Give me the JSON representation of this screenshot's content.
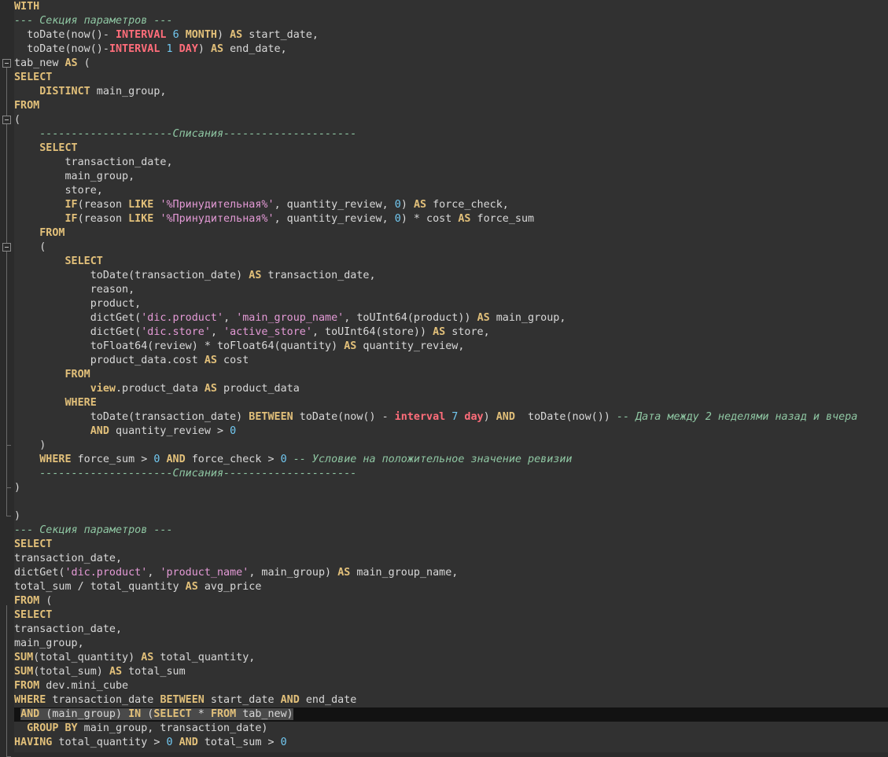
{
  "editor": {
    "lines": [
      [
        {
          "t": "WITH",
          "c": "kw"
        }
      ],
      [
        {
          "t": "--- Секция параметров ---",
          "c": "cmt"
        }
      ],
      [
        {
          "t": "  toDate(now()- ",
          "c": ""
        },
        {
          "t": "INTERVAL",
          "c": "kw2"
        },
        {
          "t": " ",
          "c": ""
        },
        {
          "t": "6",
          "c": "num"
        },
        {
          "t": " ",
          "c": ""
        },
        {
          "t": "MONTH",
          "c": "kw"
        },
        {
          "t": ") ",
          "c": ""
        },
        {
          "t": "AS",
          "c": "kw"
        },
        {
          "t": " start_date,",
          "c": ""
        }
      ],
      [
        {
          "t": "  toDate(now()-",
          "c": ""
        },
        {
          "t": "INTERVAL",
          "c": "kw2"
        },
        {
          "t": " ",
          "c": ""
        },
        {
          "t": "1",
          "c": "num"
        },
        {
          "t": " ",
          "c": ""
        },
        {
          "t": "DAY",
          "c": "kw2"
        },
        {
          "t": ") ",
          "c": ""
        },
        {
          "t": "AS",
          "c": "kw"
        },
        {
          "t": " end_date,",
          "c": ""
        }
      ],
      [
        {
          "t": "tab_new ",
          "c": ""
        },
        {
          "t": "AS",
          "c": "kw"
        },
        {
          "t": " (",
          "c": ""
        }
      ],
      [
        {
          "t": "SELECT",
          "c": "kw"
        }
      ],
      [
        {
          "t": "    ",
          "c": ""
        },
        {
          "t": "DISTINCT",
          "c": "kw"
        },
        {
          "t": " main_group,",
          "c": ""
        }
      ],
      [
        {
          "t": "FROM",
          "c": "kw"
        }
      ],
      [
        {
          "t": "(",
          "c": ""
        }
      ],
      [
        {
          "t": "    ---------------------Списания---------------------",
          "c": "cmt"
        }
      ],
      [
        {
          "t": "    ",
          "c": ""
        },
        {
          "t": "SELECT",
          "c": "kw"
        }
      ],
      [
        {
          "t": "        transaction_date,",
          "c": ""
        }
      ],
      [
        {
          "t": "        main_group,",
          "c": ""
        }
      ],
      [
        {
          "t": "        store,",
          "c": ""
        }
      ],
      [
        {
          "t": "        ",
          "c": ""
        },
        {
          "t": "IF",
          "c": "kw"
        },
        {
          "t": "(reason ",
          "c": ""
        },
        {
          "t": "LIKE",
          "c": "kw"
        },
        {
          "t": " ",
          "c": ""
        },
        {
          "t": "'%Принудительная%'",
          "c": "str"
        },
        {
          "t": ", quantity_review, ",
          "c": ""
        },
        {
          "t": "0",
          "c": "num"
        },
        {
          "t": ") ",
          "c": ""
        },
        {
          "t": "AS",
          "c": "kw"
        },
        {
          "t": " force_check,",
          "c": ""
        }
      ],
      [
        {
          "t": "        ",
          "c": ""
        },
        {
          "t": "IF",
          "c": "kw"
        },
        {
          "t": "(reason ",
          "c": ""
        },
        {
          "t": "LIKE",
          "c": "kw"
        },
        {
          "t": " ",
          "c": ""
        },
        {
          "t": "'%Принудительная%'",
          "c": "str"
        },
        {
          "t": ", quantity_review, ",
          "c": ""
        },
        {
          "t": "0",
          "c": "num"
        },
        {
          "t": ") * cost ",
          "c": ""
        },
        {
          "t": "AS",
          "c": "kw"
        },
        {
          "t": " force_sum",
          "c": ""
        }
      ],
      [
        {
          "t": "    ",
          "c": ""
        },
        {
          "t": "FROM",
          "c": "kw"
        }
      ],
      [
        {
          "t": "    (",
          "c": ""
        }
      ],
      [
        {
          "t": "        ",
          "c": ""
        },
        {
          "t": "SELECT",
          "c": "kw"
        }
      ],
      [
        {
          "t": "            toDate(transaction_date) ",
          "c": ""
        },
        {
          "t": "AS",
          "c": "kw"
        },
        {
          "t": " transaction_date,",
          "c": ""
        }
      ],
      [
        {
          "t": "            reason,",
          "c": ""
        }
      ],
      [
        {
          "t": "            product,",
          "c": ""
        }
      ],
      [
        {
          "t": "            dictGet(",
          "c": ""
        },
        {
          "t": "'dic.product'",
          "c": "str"
        },
        {
          "t": ", ",
          "c": ""
        },
        {
          "t": "'main_group_name'",
          "c": "str"
        },
        {
          "t": ", toUInt64(product)) ",
          "c": ""
        },
        {
          "t": "AS",
          "c": "kw"
        },
        {
          "t": " main_group,",
          "c": ""
        }
      ],
      [
        {
          "t": "            dictGet(",
          "c": ""
        },
        {
          "t": "'dic.store'",
          "c": "str"
        },
        {
          "t": ", ",
          "c": ""
        },
        {
          "t": "'active_store'",
          "c": "str"
        },
        {
          "t": ", toUInt64(store)) ",
          "c": ""
        },
        {
          "t": "AS",
          "c": "kw"
        },
        {
          "t": " store,",
          "c": ""
        }
      ],
      [
        {
          "t": "            toFloat64(review) * toFloat64(quantity) ",
          "c": ""
        },
        {
          "t": "AS",
          "c": "kw"
        },
        {
          "t": " quantity_review,",
          "c": ""
        }
      ],
      [
        {
          "t": "            product_data.cost ",
          "c": ""
        },
        {
          "t": "AS",
          "c": "kw"
        },
        {
          "t": " cost",
          "c": ""
        }
      ],
      [
        {
          "t": "        ",
          "c": ""
        },
        {
          "t": "FROM",
          "c": "kw"
        }
      ],
      [
        {
          "t": "            ",
          "c": ""
        },
        {
          "t": "view",
          "c": "kw"
        },
        {
          "t": ".product_data ",
          "c": ""
        },
        {
          "t": "AS",
          "c": "kw"
        },
        {
          "t": " product_data",
          "c": ""
        }
      ],
      [
        {
          "t": "        ",
          "c": ""
        },
        {
          "t": "WHERE",
          "c": "kw"
        }
      ],
      [
        {
          "t": "            toDate(transaction_date) ",
          "c": ""
        },
        {
          "t": "BETWEEN",
          "c": "kw"
        },
        {
          "t": " toDate(now() - ",
          "c": ""
        },
        {
          "t": "interval",
          "c": "kw2"
        },
        {
          "t": " ",
          "c": ""
        },
        {
          "t": "7",
          "c": "num"
        },
        {
          "t": " ",
          "c": ""
        },
        {
          "t": "day",
          "c": "kw2"
        },
        {
          "t": ") ",
          "c": ""
        },
        {
          "t": "AND",
          "c": "kw"
        },
        {
          "t": "  toDate(now()) ",
          "c": ""
        },
        {
          "t": "-- Дата между 2 неделями назад и вчера",
          "c": "cmt"
        }
      ],
      [
        {
          "t": "            ",
          "c": ""
        },
        {
          "t": "AND",
          "c": "kw"
        },
        {
          "t": " quantity_review > ",
          "c": ""
        },
        {
          "t": "0",
          "c": "num"
        }
      ],
      [
        {
          "t": "    )",
          "c": ""
        }
      ],
      [
        {
          "t": "    ",
          "c": ""
        },
        {
          "t": "WHERE",
          "c": "kw"
        },
        {
          "t": " force_sum > ",
          "c": ""
        },
        {
          "t": "0",
          "c": "num"
        },
        {
          "t": " ",
          "c": ""
        },
        {
          "t": "AND",
          "c": "kw"
        },
        {
          "t": " force_check > ",
          "c": ""
        },
        {
          "t": "0",
          "c": "num"
        },
        {
          "t": " ",
          "c": ""
        },
        {
          "t": "-- Условие на положительное значение ревизии",
          "c": "cmt"
        }
      ],
      [
        {
          "t": "    ---------------------Списания---------------------",
          "c": "cmt"
        }
      ],
      [
        {
          "t": ")",
          "c": ""
        }
      ],
      [
        {
          "t": "",
          "c": ""
        }
      ],
      [
        {
          "t": ")",
          "c": ""
        }
      ],
      [
        {
          "t": "--- Секция параметров ---",
          "c": "cmt"
        }
      ],
      [
        {
          "t": "SELECT",
          "c": "kw"
        }
      ],
      [
        {
          "t": "transaction_date,",
          "c": ""
        }
      ],
      [
        {
          "t": "dictGet(",
          "c": ""
        },
        {
          "t": "'dic.product'",
          "c": "str"
        },
        {
          "t": ", ",
          "c": ""
        },
        {
          "t": "'product_name'",
          "c": "str"
        },
        {
          "t": ", main_group) ",
          "c": ""
        },
        {
          "t": "AS",
          "c": "kw"
        },
        {
          "t": " main_group_name,",
          "c": ""
        }
      ],
      [
        {
          "t": "total_sum / total_quantity ",
          "c": ""
        },
        {
          "t": "AS",
          "c": "kw"
        },
        {
          "t": " avg_price",
          "c": ""
        }
      ],
      [
        {
          "t": "FROM",
          "c": "kw"
        },
        {
          "t": " (",
          "c": ""
        }
      ],
      [
        {
          "t": "SELECT",
          "c": "kw"
        }
      ],
      [
        {
          "t": "transaction_date,",
          "c": ""
        }
      ],
      [
        {
          "t": "main_group,",
          "c": ""
        }
      ],
      [
        {
          "t": "SUM",
          "c": "kw"
        },
        {
          "t": "(total_quantity) ",
          "c": ""
        },
        {
          "t": "AS",
          "c": "kw"
        },
        {
          "t": " total_quantity,",
          "c": ""
        }
      ],
      [
        {
          "t": "SUM",
          "c": "kw"
        },
        {
          "t": "(total_sum) ",
          "c": ""
        },
        {
          "t": "AS",
          "c": "kw"
        },
        {
          "t": " total_sum",
          "c": ""
        }
      ],
      [
        {
          "t": "FROM",
          "c": "kw"
        },
        {
          "t": " dev.mini_cube",
          "c": ""
        }
      ],
      [
        {
          "t": "WHERE",
          "c": "kw"
        },
        {
          "t": " transaction_date ",
          "c": ""
        },
        {
          "t": "BETWEEN",
          "c": "kw"
        },
        {
          "t": " start_date ",
          "c": ""
        },
        {
          "t": "AND",
          "c": "kw"
        },
        {
          "t": " end_date",
          "c": ""
        }
      ],
      [
        {
          "t": " ",
          "c": ""
        },
        {
          "t": "AND",
          "c": "kw sel"
        },
        {
          "t": " (main_group) ",
          "c": "sel"
        },
        {
          "t": "IN",
          "c": "kw sel"
        },
        {
          "t": " (",
          "c": "sel"
        },
        {
          "t": "SELECT",
          "c": "kw sel"
        },
        {
          "t": " * ",
          "c": "sel"
        },
        {
          "t": "FROM",
          "c": "kw sel"
        },
        {
          "t": " tab_new)",
          "c": "sel"
        }
      ],
      [
        {
          "t": "  ",
          "c": ""
        },
        {
          "t": "GROUP BY",
          "c": "kw"
        },
        {
          "t": " main_group, transaction_date)",
          "c": ""
        }
      ],
      [
        {
          "t": "HAVING",
          "c": "kw"
        },
        {
          "t": " total_quantity > ",
          "c": ""
        },
        {
          "t": "0",
          "c": "num"
        },
        {
          "t": " ",
          "c": ""
        },
        {
          "t": "AND",
          "c": "kw"
        },
        {
          "t": " total_sum > ",
          "c": ""
        },
        {
          "t": "0",
          "c": "num"
        }
      ]
    ],
    "current_line": 50,
    "fold_markers": [
      4,
      8,
      17
    ]
  }
}
